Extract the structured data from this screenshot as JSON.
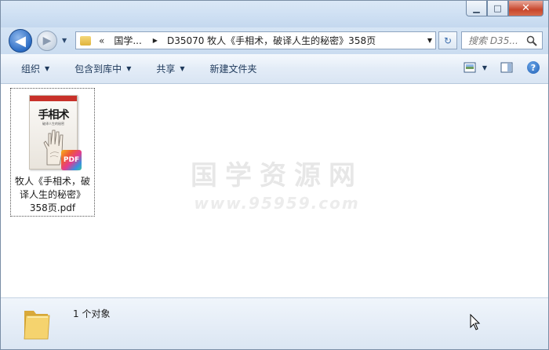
{
  "window": {
    "controls": {
      "minimize": "▁",
      "maximize": "□",
      "close": "✕"
    }
  },
  "nav": {
    "back_label": "◀",
    "forward_label": "▶",
    "history": "▼",
    "address": {
      "overflow": "«",
      "crumb_parent": "国学...",
      "separator": "▶",
      "crumb_current": "D35070 牧人《手相术，破译人生的秘密》358页",
      "dropdown": "▼"
    },
    "refresh": "↻",
    "search_placeholder": "搜索 D35..."
  },
  "toolbar": {
    "organize": "组织",
    "include_in_library": "包含到库中",
    "share": "共享",
    "new_folder": "新建文件夹"
  },
  "content": {
    "file": {
      "name": "牧人《手相术，破译人生的秘密》358页.pdf",
      "name_lines": [
        "牧人《手相术，破",
        "译人生的秘密》",
        "358页.pdf"
      ],
      "thumbnail_title": "手相术",
      "thumbnail_subtitle": "破译人生的秘密",
      "badge": "PDF"
    },
    "watermark": {
      "title": "国学资源网",
      "url": "www.95959.com"
    }
  },
  "details": {
    "count_text": "1 个对象"
  },
  "colors": {
    "accent": "#2b6cc4",
    "toolbar_text": "#1e395b",
    "pdf_red": "#ef5a34"
  }
}
